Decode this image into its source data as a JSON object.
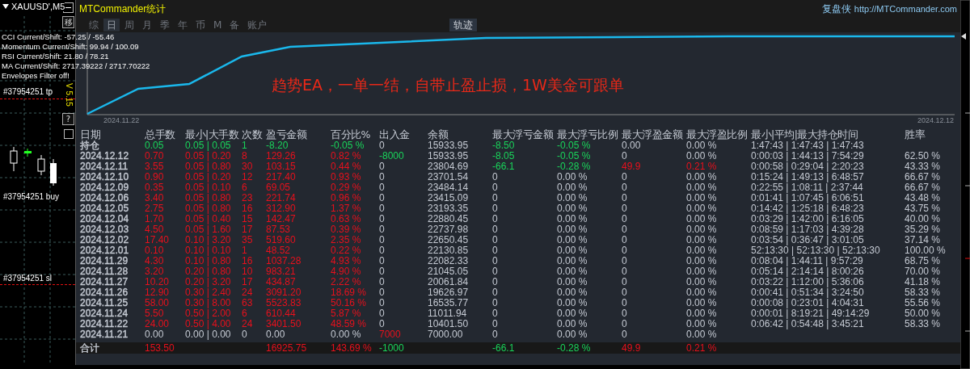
{
  "symbol": "XAUUSD',M5",
  "side_buttons": [
    "移",
    "?"
  ],
  "version": "V 5.15",
  "indicators": [
    "CCI Current/Shift: -57.25 / -55.46",
    "Momentum Current/Shift: 99.94 / 100.09",
    "RSI Current/Shift: 21.80 / 78.21",
    "MA Current/Shift: 2717.39222 / 2717.70222",
    "Envelopes Filter off!"
  ],
  "order_labels": [
    "#37954251 tp",
    "#37954251 buy",
    "#37954251 sl"
  ],
  "window": {
    "title": "MTCommander统计",
    "brand": "复盘侠",
    "url": "http://MTCommander.com"
  },
  "tabs": [
    {
      "label": "综",
      "selected": false
    },
    {
      "label": "日",
      "selected": true
    },
    {
      "label": "周",
      "selected": false
    },
    {
      "label": "月",
      "selected": false
    },
    {
      "label": "季",
      "selected": false
    },
    {
      "label": "年",
      "selected": false
    },
    {
      "label": "币",
      "selected": false
    },
    {
      "label": "M",
      "selected": false
    },
    {
      "label": "备",
      "selected": false
    },
    {
      "label": "账户",
      "selected": false
    }
  ],
  "view_button": {
    "label": "轨迹",
    "selected": true
  },
  "chart": {
    "start_label": "2024.11.22",
    "end_label": "2024.12.12",
    "annotation": "趋势EA，一单一结，自带止盈止损，1W美金可跟单"
  },
  "table": {
    "columns": [
      "日期",
      "总手数",
      "最小|大手数",
      "次数",
      "盈亏金额",
      "百分比%",
      "出入金",
      "余额",
      "最大浮亏金额",
      "最大浮亏比例",
      "最大浮盈金额",
      "最大浮盈比例",
      "最小|平均|最大持仓时间",
      "胜率"
    ],
    "rows": [
      {
        "cells": [
          {
            "text": "持仓",
            "color": "#c5cad3"
          },
          {
            "text": "0.05",
            "color": "#19d35a"
          },
          {
            "text": "0.05 | 0.05",
            "color": "#19d35a"
          },
          {
            "text": "1",
            "color": "#19d35a"
          },
          {
            "text": "-8.20",
            "color": "#19d35a"
          },
          {
            "text": "-0.05 %",
            "color": "#19d35a"
          },
          {
            "text": "0",
            "color": "#c5cad3"
          },
          {
            "text": "15933.95",
            "color": "#c5cad3"
          },
          {
            "text": "-8.50",
            "color": "#19d35a"
          },
          {
            "text": "-0.05 %",
            "color": "#19d35a"
          },
          {
            "text": "0.00",
            "color": "#c5cad3"
          },
          {
            "text": "0.00 %",
            "color": "#c5cad3"
          },
          {
            "text": "1:47:43 | 1:47:43 | 1:47:43",
            "color": "#c5cad3"
          }
        ]
      },
      {
        "cells": [
          {
            "text": "2024.12.12",
            "color": "#c5cad3"
          },
          {
            "text": "0.70",
            "color": "#e8101c"
          },
          {
            "text": "0.05 | 0.20",
            "color": "#e8101c"
          },
          {
            "text": "8",
            "color": "#e8101c"
          },
          {
            "text": "129.26",
            "color": "#e8101c"
          },
          {
            "text": "0.82 %",
            "color": "#e8101c"
          },
          {
            "text": "-8000",
            "color": "#19d35a"
          },
          {
            "text": "15933.95",
            "color": "#c5cad3"
          },
          {
            "text": "-8.05",
            "color": "#19d35a"
          },
          {
            "text": "-0.05 %",
            "color": "#19d35a"
          },
          {
            "text": "0",
            "color": "#c5cad3"
          },
          {
            "text": "0.00 %",
            "color": "#c5cad3"
          },
          {
            "text": "0:00:03 | 1:44:13 | 7:54:29",
            "color": "#c5cad3"
          },
          {
            "text": "62.50 %",
            "color": "#c5cad3"
          }
        ]
      },
      {
        "cells": [
          {
            "text": "2024.12.11",
            "color": "#c5cad3"
          },
          {
            "text": "3.55",
            "color": "#e8101c"
          },
          {
            "text": "0.05 | 0.80",
            "color": "#e8101c"
          },
          {
            "text": "30",
            "color": "#e8101c"
          },
          {
            "text": "103.15",
            "color": "#e8101c"
          },
          {
            "text": "0.44 %",
            "color": "#e8101c"
          },
          {
            "text": "0",
            "color": "#c5cad3"
          },
          {
            "text": "23804.69",
            "color": "#c5cad3"
          },
          {
            "text": "-66.1",
            "color": "#19d35a"
          },
          {
            "text": "-0.28 %",
            "color": "#19d35a"
          },
          {
            "text": "49.9",
            "color": "#e8101c"
          },
          {
            "text": "0.21 %",
            "color": "#e8101c"
          },
          {
            "text": "0:00:58 | 0:29:04 | 2:20:23",
            "color": "#c5cad3"
          },
          {
            "text": "43.33 %",
            "color": "#c5cad3"
          }
        ]
      },
      {
        "cells": [
          {
            "text": "2024.12.10",
            "color": "#c5cad3"
          },
          {
            "text": "0.90",
            "color": "#e8101c"
          },
          {
            "text": "0.05 | 0.20",
            "color": "#e8101c"
          },
          {
            "text": "12",
            "color": "#e8101c"
          },
          {
            "text": "217.40",
            "color": "#e8101c"
          },
          {
            "text": "0.93 %",
            "color": "#e8101c"
          },
          {
            "text": "0",
            "color": "#c5cad3"
          },
          {
            "text": "23701.54",
            "color": "#c5cad3"
          },
          {
            "text": "0",
            "color": "#c5cad3"
          },
          {
            "text": "0.00 %",
            "color": "#c5cad3"
          },
          {
            "text": "0",
            "color": "#c5cad3"
          },
          {
            "text": "0.00 %",
            "color": "#c5cad3"
          },
          {
            "text": "0:15:24 | 1:49:13 | 6:48:57",
            "color": "#c5cad3"
          },
          {
            "text": "66.67 %",
            "color": "#c5cad3"
          }
        ]
      },
      {
        "cells": [
          {
            "text": "2024.12.09",
            "color": "#c5cad3"
          },
          {
            "text": "0.35",
            "color": "#e8101c"
          },
          {
            "text": "0.05 | 0.10",
            "color": "#e8101c"
          },
          {
            "text": "6",
            "color": "#e8101c"
          },
          {
            "text": "69.05",
            "color": "#e8101c"
          },
          {
            "text": "0.29 %",
            "color": "#e8101c"
          },
          {
            "text": "0",
            "color": "#c5cad3"
          },
          {
            "text": "23484.14",
            "color": "#c5cad3"
          },
          {
            "text": "0",
            "color": "#c5cad3"
          },
          {
            "text": "0.00 %",
            "color": "#c5cad3"
          },
          {
            "text": "0",
            "color": "#c5cad3"
          },
          {
            "text": "0.00 %",
            "color": "#c5cad3"
          },
          {
            "text": "0:22:55 | 1:08:11 | 2:37:44",
            "color": "#c5cad3"
          },
          {
            "text": "66.67 %",
            "color": "#c5cad3"
          }
        ]
      },
      {
        "cells": [
          {
            "text": "2024.12.06",
            "color": "#c5cad3"
          },
          {
            "text": "3.40",
            "color": "#e8101c"
          },
          {
            "text": "0.05 | 0.80",
            "color": "#e8101c"
          },
          {
            "text": "23",
            "color": "#e8101c"
          },
          {
            "text": "221.74",
            "color": "#e8101c"
          },
          {
            "text": "0.96 %",
            "color": "#e8101c"
          },
          {
            "text": "0",
            "color": "#c5cad3"
          },
          {
            "text": "23415.09",
            "color": "#c5cad3"
          },
          {
            "text": "0",
            "color": "#c5cad3"
          },
          {
            "text": "0.00 %",
            "color": "#c5cad3"
          },
          {
            "text": "0",
            "color": "#c5cad3"
          },
          {
            "text": "0.00 %",
            "color": "#c5cad3"
          },
          {
            "text": "0:01:41 | 1:07:45 | 6:06:51",
            "color": "#c5cad3"
          },
          {
            "text": "43.48 %",
            "color": "#c5cad3"
          }
        ]
      },
      {
        "cells": [
          {
            "text": "2024.12.05",
            "color": "#c5cad3"
          },
          {
            "text": "2.75",
            "color": "#e8101c"
          },
          {
            "text": "0.05 | 0.80",
            "color": "#e8101c"
          },
          {
            "text": "16",
            "color": "#e8101c"
          },
          {
            "text": "312.90",
            "color": "#e8101c"
          },
          {
            "text": "1.37 %",
            "color": "#e8101c"
          },
          {
            "text": "0",
            "color": "#c5cad3"
          },
          {
            "text": "23193.35",
            "color": "#c5cad3"
          },
          {
            "text": "0",
            "color": "#c5cad3"
          },
          {
            "text": "0.00 %",
            "color": "#c5cad3"
          },
          {
            "text": "0",
            "color": "#c5cad3"
          },
          {
            "text": "0.00 %",
            "color": "#c5cad3"
          },
          {
            "text": "0:14:42 | 1:25:18 | 6:48:23",
            "color": "#c5cad3"
          },
          {
            "text": "43.75 %",
            "color": "#c5cad3"
          }
        ]
      },
      {
        "cells": [
          {
            "text": "2024.12.04",
            "color": "#c5cad3"
          },
          {
            "text": "1.70",
            "color": "#e8101c"
          },
          {
            "text": "0.05 | 0.40",
            "color": "#e8101c"
          },
          {
            "text": "15",
            "color": "#e8101c"
          },
          {
            "text": "142.47",
            "color": "#e8101c"
          },
          {
            "text": "0.63 %",
            "color": "#e8101c"
          },
          {
            "text": "0",
            "color": "#c5cad3"
          },
          {
            "text": "22880.45",
            "color": "#c5cad3"
          },
          {
            "text": "0",
            "color": "#c5cad3"
          },
          {
            "text": "0.00 %",
            "color": "#c5cad3"
          },
          {
            "text": "0",
            "color": "#c5cad3"
          },
          {
            "text": "0.00 %",
            "color": "#c5cad3"
          },
          {
            "text": "0:03:29 | 1:42:00 | 6:16:05",
            "color": "#c5cad3"
          },
          {
            "text": "40.00 %",
            "color": "#c5cad3"
          }
        ]
      },
      {
        "cells": [
          {
            "text": "2024.12.03",
            "color": "#c5cad3"
          },
          {
            "text": "4.50",
            "color": "#e8101c"
          },
          {
            "text": "0.05 | 1.60",
            "color": "#e8101c"
          },
          {
            "text": "17",
            "color": "#e8101c"
          },
          {
            "text": "87.53",
            "color": "#e8101c"
          },
          {
            "text": "0.39 %",
            "color": "#e8101c"
          },
          {
            "text": "0",
            "color": "#c5cad3"
          },
          {
            "text": "22737.98",
            "color": "#c5cad3"
          },
          {
            "text": "0",
            "color": "#c5cad3"
          },
          {
            "text": "0.00 %",
            "color": "#c5cad3"
          },
          {
            "text": "0",
            "color": "#c5cad3"
          },
          {
            "text": "0.00 %",
            "color": "#c5cad3"
          },
          {
            "text": "0:08:59 | 1:17:03 | 4:39:28",
            "color": "#c5cad3"
          },
          {
            "text": "35.29 %",
            "color": "#c5cad3"
          }
        ]
      },
      {
        "cells": [
          {
            "text": "2024.12.02",
            "color": "#c5cad3"
          },
          {
            "text": "17.40",
            "color": "#e8101c"
          },
          {
            "text": "0.10 | 3.20",
            "color": "#e8101c"
          },
          {
            "text": "35",
            "color": "#e8101c"
          },
          {
            "text": "519.60",
            "color": "#e8101c"
          },
          {
            "text": "2.35 %",
            "color": "#e8101c"
          },
          {
            "text": "0",
            "color": "#c5cad3"
          },
          {
            "text": "22650.45",
            "color": "#c5cad3"
          },
          {
            "text": "0",
            "color": "#c5cad3"
          },
          {
            "text": "0.00 %",
            "color": "#c5cad3"
          },
          {
            "text": "0",
            "color": "#c5cad3"
          },
          {
            "text": "0.00 %",
            "color": "#c5cad3"
          },
          {
            "text": "0:03:54 | 0:36:47 | 3:01:05",
            "color": "#c5cad3"
          },
          {
            "text": "37.14 %",
            "color": "#c5cad3"
          }
        ]
      },
      {
        "cells": [
          {
            "text": "2024.12.01",
            "color": "#c5cad3"
          },
          {
            "text": "0.10",
            "color": "#e8101c"
          },
          {
            "text": "0.10 | 0.10",
            "color": "#e8101c"
          },
          {
            "text": "1",
            "color": "#e8101c"
          },
          {
            "text": "48.52",
            "color": "#e8101c"
          },
          {
            "text": "0.22 %",
            "color": "#e8101c"
          },
          {
            "text": "0",
            "color": "#c5cad3"
          },
          {
            "text": "22130.85",
            "color": "#c5cad3"
          },
          {
            "text": "0",
            "color": "#c5cad3"
          },
          {
            "text": "0.00 %",
            "color": "#c5cad3"
          },
          {
            "text": "0",
            "color": "#c5cad3"
          },
          {
            "text": "0.00 %",
            "color": "#c5cad3"
          },
          {
            "text": "52:13:30 | 52:13:30 | 52:13:30",
            "color": "#c5cad3"
          },
          {
            "text": "100.00 %",
            "color": "#c5cad3"
          }
        ]
      },
      {
        "cells": [
          {
            "text": "2024.11.29",
            "color": "#c5cad3"
          },
          {
            "text": "4.30",
            "color": "#e8101c"
          },
          {
            "text": "0.10 | 0.80",
            "color": "#e8101c"
          },
          {
            "text": "16",
            "color": "#e8101c"
          },
          {
            "text": "1037.28",
            "color": "#e8101c"
          },
          {
            "text": "4.93 %",
            "color": "#e8101c"
          },
          {
            "text": "0",
            "color": "#c5cad3"
          },
          {
            "text": "22082.33",
            "color": "#c5cad3"
          },
          {
            "text": "0",
            "color": "#c5cad3"
          },
          {
            "text": "0.00 %",
            "color": "#c5cad3"
          },
          {
            "text": "0",
            "color": "#c5cad3"
          },
          {
            "text": "0.00 %",
            "color": "#c5cad3"
          },
          {
            "text": "0:08:04 | 1:44:11 | 9:57:29",
            "color": "#c5cad3"
          },
          {
            "text": "68.75 %",
            "color": "#c5cad3"
          }
        ]
      },
      {
        "cells": [
          {
            "text": "2024.11.28",
            "color": "#c5cad3"
          },
          {
            "text": "3.20",
            "color": "#e8101c"
          },
          {
            "text": "0.20 | 0.80",
            "color": "#e8101c"
          },
          {
            "text": "10",
            "color": "#e8101c"
          },
          {
            "text": "983.21",
            "color": "#e8101c"
          },
          {
            "text": "4.90 %",
            "color": "#e8101c"
          },
          {
            "text": "0",
            "color": "#c5cad3"
          },
          {
            "text": "21045.05",
            "color": "#c5cad3"
          },
          {
            "text": "0",
            "color": "#c5cad3"
          },
          {
            "text": "0.00 %",
            "color": "#c5cad3"
          },
          {
            "text": "0",
            "color": "#c5cad3"
          },
          {
            "text": "0.00 %",
            "color": "#c5cad3"
          },
          {
            "text": "0:05:14 | 2:14:14 | 8:00:26",
            "color": "#c5cad3"
          },
          {
            "text": "70.00 %",
            "color": "#c5cad3"
          }
        ]
      },
      {
        "cells": [
          {
            "text": "2024.11.27",
            "color": "#c5cad3"
          },
          {
            "text": "10.20",
            "color": "#e8101c"
          },
          {
            "text": "0.20 | 3.20",
            "color": "#e8101c"
          },
          {
            "text": "17",
            "color": "#e8101c"
          },
          {
            "text": "434.87",
            "color": "#e8101c"
          },
          {
            "text": "2.22 %",
            "color": "#e8101c"
          },
          {
            "text": "0",
            "color": "#c5cad3"
          },
          {
            "text": "20061.84",
            "color": "#c5cad3"
          },
          {
            "text": "0",
            "color": "#c5cad3"
          },
          {
            "text": "0.00 %",
            "color": "#c5cad3"
          },
          {
            "text": "0",
            "color": "#c5cad3"
          },
          {
            "text": "0.00 %",
            "color": "#c5cad3"
          },
          {
            "text": "0:03:22 | 1:12:00 | 5:36:06",
            "color": "#c5cad3"
          },
          {
            "text": "41.18 %",
            "color": "#c5cad3"
          }
        ]
      },
      {
        "cells": [
          {
            "text": "2024.11.26",
            "color": "#c5cad3"
          },
          {
            "text": "12.90",
            "color": "#e8101c"
          },
          {
            "text": "0.30 | 2.40",
            "color": "#e8101c"
          },
          {
            "text": "24",
            "color": "#e8101c"
          },
          {
            "text": "3091.20",
            "color": "#e8101c"
          },
          {
            "text": "18.69 %",
            "color": "#e8101c"
          },
          {
            "text": "0",
            "color": "#c5cad3"
          },
          {
            "text": "19626.97",
            "color": "#c5cad3"
          },
          {
            "text": "0",
            "color": "#c5cad3"
          },
          {
            "text": "0.00 %",
            "color": "#c5cad3"
          },
          {
            "text": "0",
            "color": "#c5cad3"
          },
          {
            "text": "0.00 %",
            "color": "#c5cad3"
          },
          {
            "text": "0:00:41 | 0:51:34 | 3:24:50",
            "color": "#c5cad3"
          },
          {
            "text": "58.33 %",
            "color": "#c5cad3"
          }
        ]
      },
      {
        "cells": [
          {
            "text": "2024.11.25",
            "color": "#c5cad3"
          },
          {
            "text": "58.00",
            "color": "#e8101c"
          },
          {
            "text": "0.30 | 8.00",
            "color": "#e8101c"
          },
          {
            "text": "63",
            "color": "#e8101c"
          },
          {
            "text": "5523.83",
            "color": "#e8101c"
          },
          {
            "text": "50.16 %",
            "color": "#e8101c"
          },
          {
            "text": "0",
            "color": "#c5cad3"
          },
          {
            "text": "16535.77",
            "color": "#c5cad3"
          },
          {
            "text": "0",
            "color": "#c5cad3"
          },
          {
            "text": "0.00 %",
            "color": "#c5cad3"
          },
          {
            "text": "0",
            "color": "#c5cad3"
          },
          {
            "text": "0.00 %",
            "color": "#c5cad3"
          },
          {
            "text": "0:00:08 | 0:23:01 | 4:04:31",
            "color": "#c5cad3"
          },
          {
            "text": "55.56 %",
            "color": "#c5cad3"
          }
        ]
      },
      {
        "cells": [
          {
            "text": "2024.11.24",
            "color": "#c5cad3"
          },
          {
            "text": "5.50",
            "color": "#e8101c"
          },
          {
            "text": "0.50 | 2.00",
            "color": "#e8101c"
          },
          {
            "text": "6",
            "color": "#e8101c"
          },
          {
            "text": "610.44",
            "color": "#e8101c"
          },
          {
            "text": "5.87 %",
            "color": "#e8101c"
          },
          {
            "text": "0",
            "color": "#c5cad3"
          },
          {
            "text": "11011.94",
            "color": "#c5cad3"
          },
          {
            "text": "0",
            "color": "#c5cad3"
          },
          {
            "text": "0.00 %",
            "color": "#c5cad3"
          },
          {
            "text": "0",
            "color": "#c5cad3"
          },
          {
            "text": "0.00 %",
            "color": "#c5cad3"
          },
          {
            "text": "0:00:01 | 8:19:21 | 49:14:29",
            "color": "#c5cad3"
          },
          {
            "text": "50.00 %",
            "color": "#c5cad3"
          }
        ]
      },
      {
        "cells": [
          {
            "text": "2024.11.22",
            "color": "#c5cad3"
          },
          {
            "text": "24.00",
            "color": "#e8101c"
          },
          {
            "text": "0.50 | 4.00",
            "color": "#e8101c"
          },
          {
            "text": "24",
            "color": "#e8101c"
          },
          {
            "text": "3401.50",
            "color": "#e8101c"
          },
          {
            "text": "48.59 %",
            "color": "#e8101c"
          },
          {
            "text": "0",
            "color": "#c5cad3"
          },
          {
            "text": "10401.50",
            "color": "#c5cad3"
          },
          {
            "text": "0",
            "color": "#c5cad3"
          },
          {
            "text": "0.00 %",
            "color": "#c5cad3"
          },
          {
            "text": "0",
            "color": "#c5cad3"
          },
          {
            "text": "0.00 %",
            "color": "#c5cad3"
          },
          {
            "text": "0:06:42 | 0:54:48 | 3:45:21",
            "color": "#c5cad3"
          },
          {
            "text": "58.33 %",
            "color": "#c5cad3"
          }
        ]
      },
      {
        "cells": [
          {
            "text": "2024.11.21",
            "color": "#c5cad3"
          },
          {
            "text": "0.00",
            "color": "#c5cad3"
          },
          {
            "text": "0.00 | 0.00",
            "color": "#c5cad3"
          },
          {
            "text": "0",
            "color": "#c5cad3"
          },
          {
            "text": "0.00",
            "color": "#c5cad3"
          },
          {
            "text": "0.00 %",
            "color": "#c5cad3"
          },
          {
            "text": "7000",
            "color": "#e8101c"
          },
          {
            "text": "7000.00",
            "color": "#c5cad3"
          },
          {
            "text": "0",
            "color": "#c5cad3"
          },
          {
            "text": "0.00 %",
            "color": "#c5cad3"
          },
          {
            "text": "0",
            "color": "#c5cad3"
          },
          {
            "text": "0.00 %",
            "color": "#c5cad3"
          }
        ]
      }
    ],
    "total": {
      "cells": [
        {
          "text": "合计",
          "color": "#c5cad3"
        },
        {
          "text": "153.50",
          "color": "#e8101c"
        },
        null,
        null,
        {
          "text": "16925.75",
          "color": "#e8101c"
        },
        {
          "text": "143.69 %",
          "color": "#e8101c"
        },
        {
          "text": "-1000",
          "color": "#19d35a"
        },
        null,
        {
          "text": "-66.1",
          "color": "#19d35a"
        },
        {
          "text": "-0.28 %",
          "color": "#19d35a"
        },
        {
          "text": "49.9",
          "color": "#e8101c"
        },
        {
          "text": "0.21 %",
          "color": "#e8101c"
        }
      ]
    }
  }
}
